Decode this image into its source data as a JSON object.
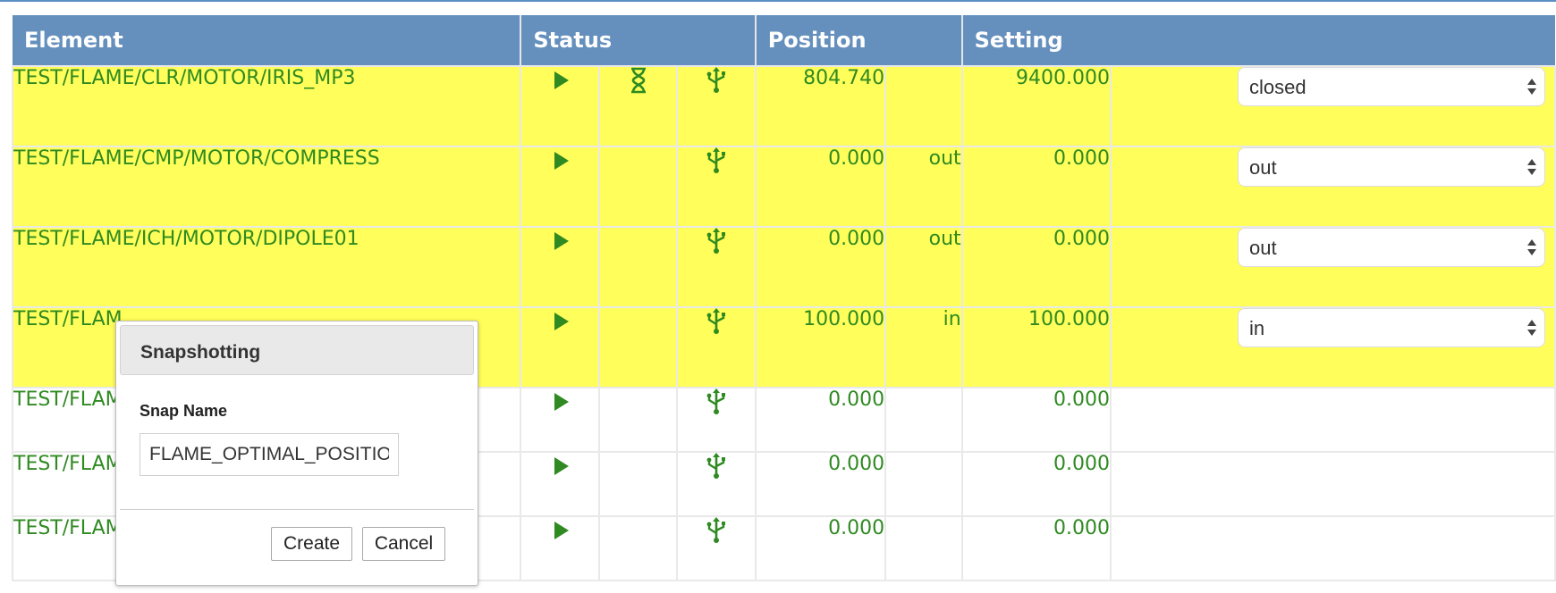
{
  "headers": {
    "element": "Element",
    "status": "Status",
    "position": "Position",
    "setting": "Setting"
  },
  "rows": [
    {
      "element": "TEST/FLAME/CLR/MOTOR/IRIS_MP3",
      "position": "804.740",
      "position_unit": "",
      "setting": "9400.000",
      "select": "closed",
      "hourglass": true,
      "highlight": true
    },
    {
      "element": "TEST/FLAME/CMP/MOTOR/COMPRESS",
      "position": "0.000",
      "position_unit": "out",
      "setting": "0.000",
      "select": "out",
      "hourglass": false,
      "highlight": true
    },
    {
      "element": "TEST/FLAME/ICH/MOTOR/DIPOLE01",
      "position": "0.000",
      "position_unit": "out",
      "setting": "0.000",
      "select": "out",
      "hourglass": false,
      "highlight": true
    },
    {
      "element": "TEST/FLAM",
      "position": "100.000",
      "position_unit": "in",
      "setting": "100.000",
      "select": "in",
      "hourglass": false,
      "highlight": true
    },
    {
      "element": "TEST/FLAM",
      "position": "0.000",
      "position_unit": "",
      "setting": "0.000",
      "select": "",
      "hourglass": false,
      "highlight": false
    },
    {
      "element": "TEST/FLAM",
      "position": "0.000",
      "position_unit": "",
      "setting": "0.000",
      "select": "",
      "hourglass": false,
      "highlight": false
    },
    {
      "element": "TEST/FLAM",
      "position": "0.000",
      "position_unit": "",
      "setting": "0.000",
      "select": "",
      "hourglass": false,
      "highlight": false
    }
  ],
  "icons": {
    "run": "play-icon",
    "moving": "hourglass-icon",
    "device": "usb-icon"
  },
  "colors": {
    "header_bg": "#6590bd",
    "highlight_bg": "#fffe5a",
    "text_green": "#2f8a21"
  },
  "dialog": {
    "title": "Snapshotting",
    "field_label": "Snap Name",
    "field_value": "FLAME_OPTIMAL_POSITION",
    "create_label": "Create",
    "cancel_label": "Cancel"
  }
}
